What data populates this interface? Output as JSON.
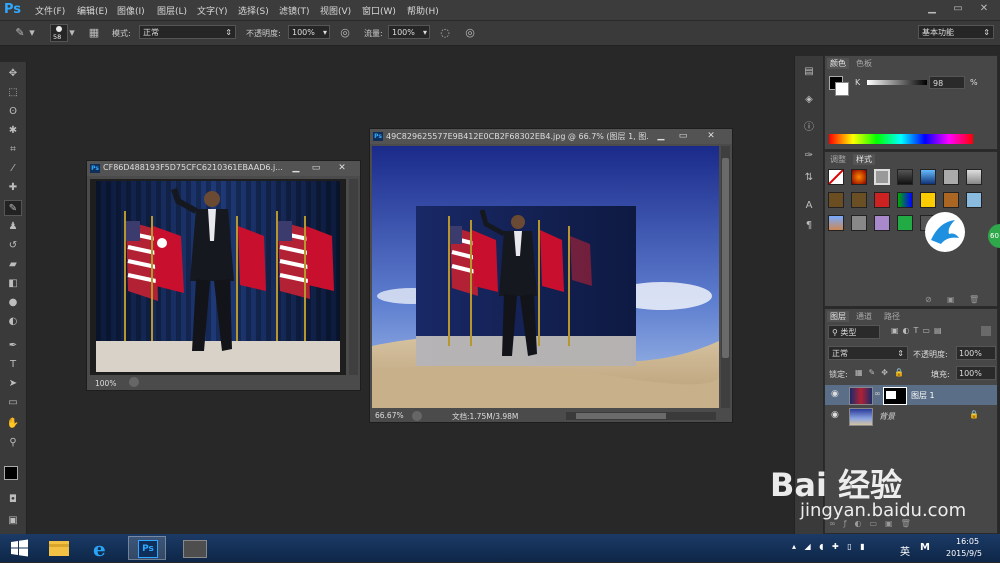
{
  "app": {
    "logo": "Ps"
  },
  "menu": [
    "文件(F)",
    "编辑(E)",
    "图像(I)",
    "图层(L)",
    "文字(Y)",
    "选择(S)",
    "滤镜(T)",
    "视图(V)",
    "窗口(W)",
    "帮助(H)"
  ],
  "options": {
    "brush_size": "58",
    "mode_label": "模式:",
    "mode_value": "正常",
    "opacity_label": "不透明度:",
    "opacity_value": "100%",
    "flow_label": "流量:",
    "flow_value": "100%",
    "workspace": "基本功能"
  },
  "doc1": {
    "title": "CF86D488193F5D75CFC6210361EBAAD6.j...",
    "zoom": "100%"
  },
  "doc2": {
    "title": "49C829625577E9B412E0CB2F68302EB4.jpg @ 66.7% (图层 1, 图...",
    "zoom": "66.67%",
    "doc_info": "文档:1.75M/3.98M"
  },
  "color_panel": {
    "tabs": [
      "颜色",
      "色板"
    ],
    "channel": "K",
    "value": "98",
    "unit": "%"
  },
  "style_panel": {
    "tabs": [
      "调整",
      "样式"
    ]
  },
  "layers_panel": {
    "tabs": [
      "图层",
      "通道",
      "路径"
    ],
    "filter_kind": "类型",
    "blend_mode": "正常",
    "opacity_label": "不透明度:",
    "opacity_value": "100%",
    "lock_label": "锁定:",
    "fill_label": "填充:",
    "fill_value": "100%",
    "layers": [
      {
        "name": "图层 1"
      },
      {
        "name": "背景"
      }
    ]
  },
  "taskbar": {
    "ime": "英",
    "time": "16:05",
    "date": "2015/9/5"
  },
  "watermark": {
    "brand": "Bai 经验",
    "url": "jingyan.baidu.com"
  },
  "colors": {
    "ps_blue": "#31a8ff",
    "panel_bg": "#474747",
    "workspace": "#282828"
  },
  "icons": [
    "brush-icon",
    "move-icon",
    "marquee-icon",
    "lasso-icon",
    "crop-icon",
    "eyedropper-icon",
    "eye-icon",
    "lock-icon",
    "windows-start-icon",
    "ie-icon",
    "explorer-icon"
  ]
}
